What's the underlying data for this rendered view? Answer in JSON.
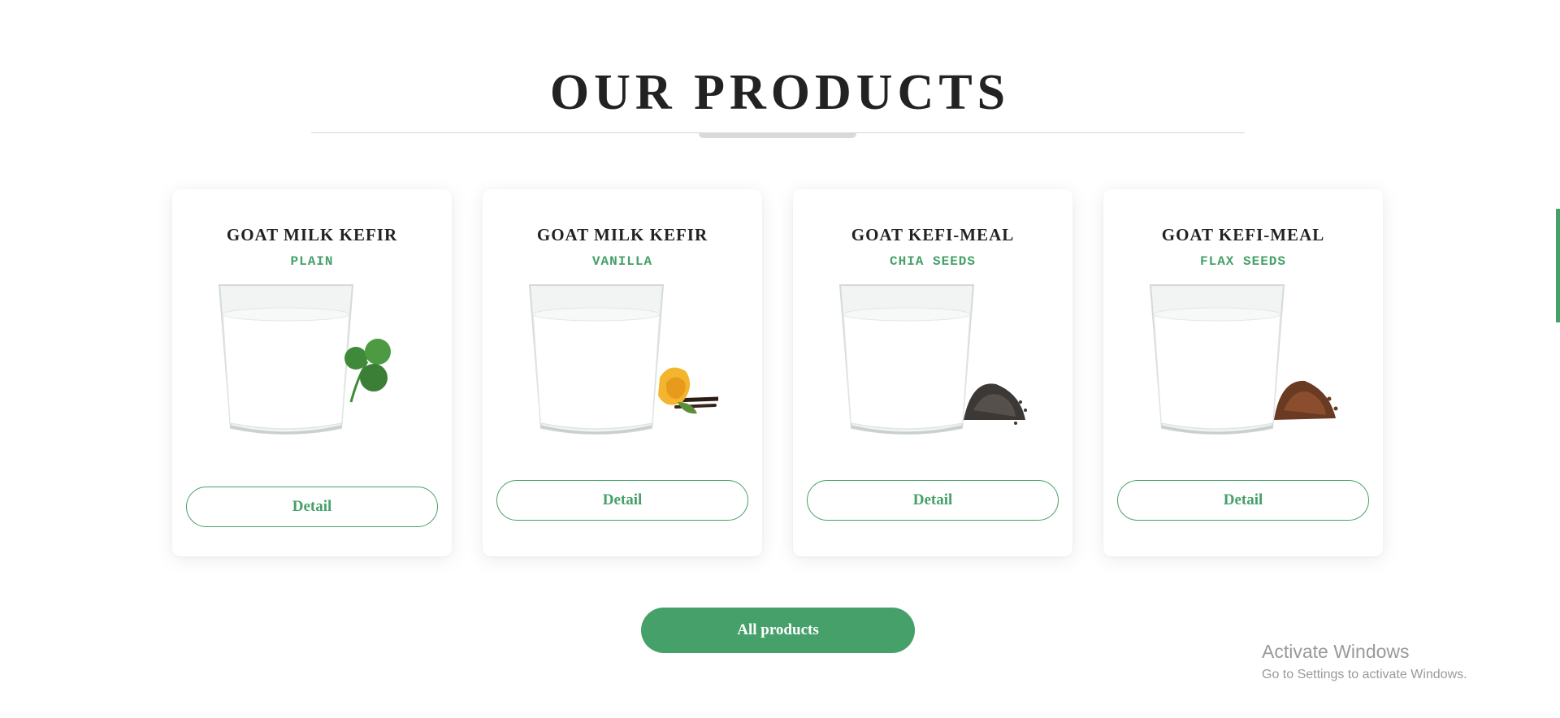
{
  "section": {
    "title": "OUR PRODUCTS"
  },
  "products": [
    {
      "title": "GOAT MILK KEFIR",
      "subtitle": "PLAIN",
      "garnish": "clover-leaf-icon",
      "button_label": "Detail"
    },
    {
      "title": "GOAT MILK KEFIR",
      "subtitle": "VANILLA",
      "garnish": "vanilla-flower-icon",
      "button_label": "Detail"
    },
    {
      "title": "GOAT KEFI-MEAL",
      "subtitle": "CHIA SEEDS",
      "garnish": "chia-seeds-icon",
      "button_label": "Detail"
    },
    {
      "title": "GOAT KEFI-MEAL",
      "subtitle": "FLAX SEEDS",
      "garnish": "flax-seeds-icon",
      "button_label": "Detail"
    }
  ],
  "all_products_label": "All products",
  "watermark": {
    "title": "Activate Windows",
    "subtitle": "Go to Settings to activate Windows."
  },
  "colors": {
    "accent": "#46a06a",
    "title": "#222222"
  }
}
